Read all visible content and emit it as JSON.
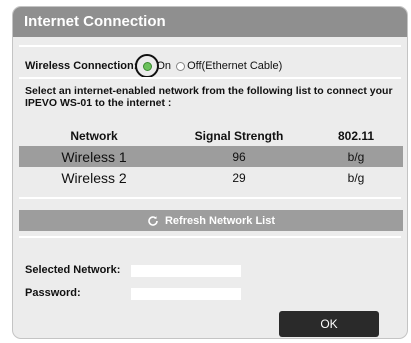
{
  "dialog": {
    "title": "Internet Connection"
  },
  "wireless": {
    "label": "Wireless Connection:",
    "option_on": "On",
    "option_off": "Off(Ethernet Cable)",
    "selected": "On"
  },
  "instructions": "Select an internet-enabled network from the following list to connect your IPEVO WS-01 to the internet :",
  "network_table": {
    "columns": [
      "Network",
      "Signal Strength",
      "802.11"
    ],
    "rows": [
      {
        "network": "Wireless 1",
        "signal": "96",
        "standard": "b/g"
      },
      {
        "network": "Wireless 2",
        "signal": "29",
        "standard": "b/g"
      }
    ]
  },
  "refresh": {
    "label": "Refresh Network List",
    "icon": "refresh-icon"
  },
  "form": {
    "selected_network_label": "Selected Network:",
    "selected_network_value": "",
    "password_label": "Password:",
    "password_value": ""
  },
  "ok_label": "OK",
  "colors": {
    "titlebar": "#8f8f8f",
    "panel": "#ececec",
    "row_highlight": "#9d9d9d",
    "radio_on": "#6cc25c",
    "ok_button": "#2a2a2a"
  }
}
